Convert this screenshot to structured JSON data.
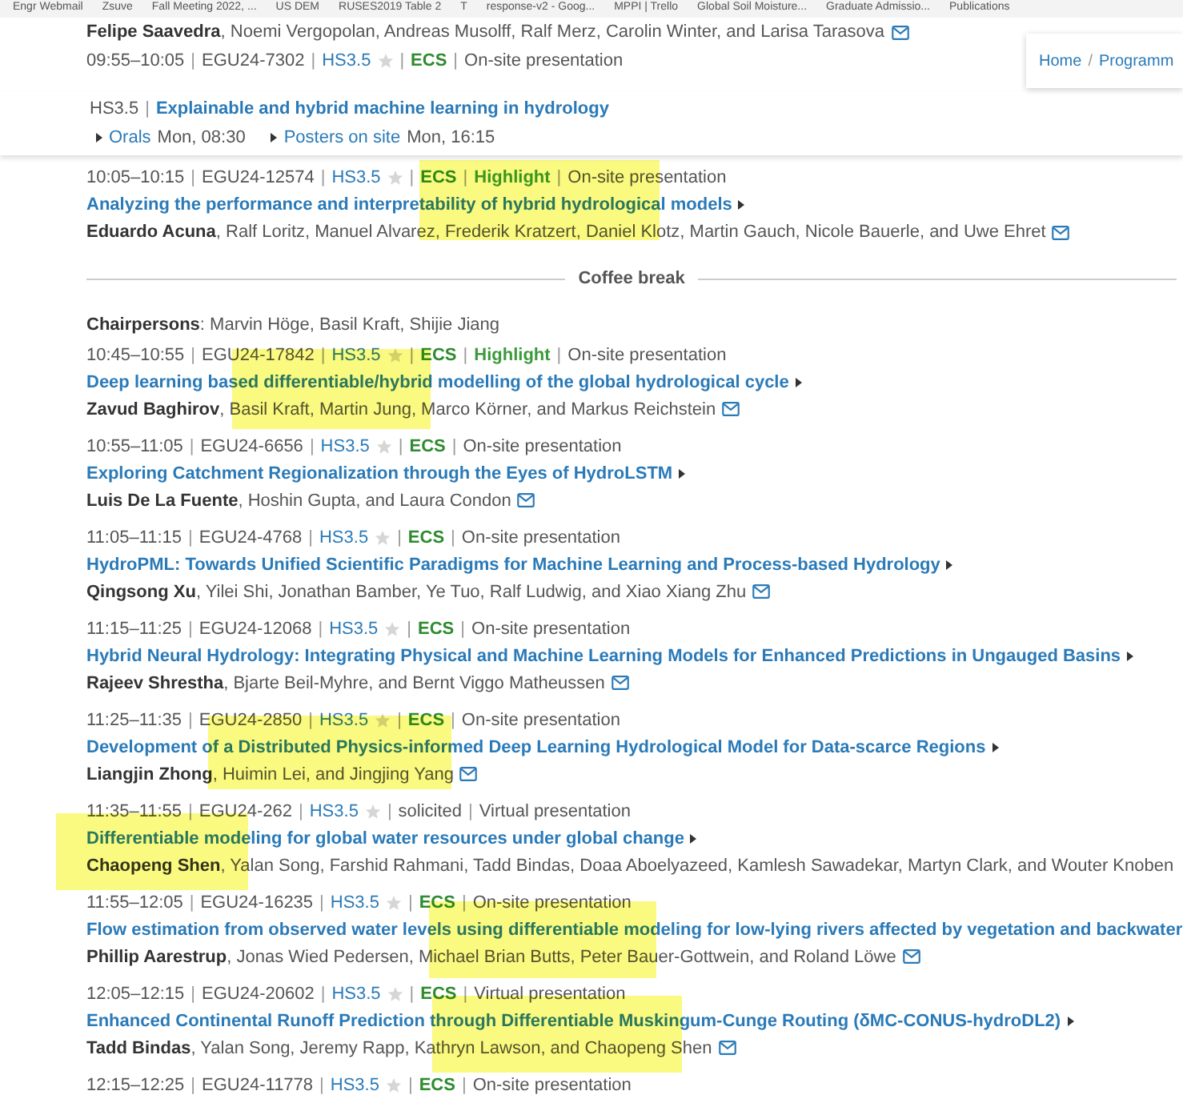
{
  "bookmarks": [
    "Engr Webmail",
    "Zsuve",
    "Fall Meeting 2022, ...",
    "US DEM",
    "RUSES2019 Table 2",
    "T",
    "response-v2 - Goog...",
    "MPPI | Trello",
    "Global Soil Moisture...",
    "Graduate Admissio...",
    "Publications"
  ],
  "separator": "|",
  "breadcrumb": {
    "items": [
      "Home",
      "Programm"
    ],
    "separator": "/"
  },
  "previous": {
    "first_author": "Felipe Saavedra",
    "authors": ", Noemi Vergopolan, Andreas Musolff, Ralf Merz, Carolin Winter, and Larisa Tarasova",
    "meta": {
      "time": "09:55–10:05",
      "abstract_id": "EGU24-7302",
      "session": "HS3.5",
      "starred": false,
      "tags": [
        {
          "kind": "ecs",
          "label": "ECS"
        }
      ],
      "presentation": "On-site presentation"
    }
  },
  "session_header": {
    "code": "HS3.5",
    "title": "Explainable and hybrid machine learning in hydrology",
    "links": [
      {
        "label": "Orals",
        "when": "Mon, 08:30"
      },
      {
        "label": "Posters on site",
        "when": "Mon, 16:15"
      }
    ]
  },
  "blocks": [
    {
      "kind": "talk",
      "time": "10:05–10:15",
      "abstract_id": "EGU24-12574",
      "session": "HS3.5",
      "starred": false,
      "tags": [
        {
          "kind": "ecs",
          "label": "ECS"
        },
        {
          "kind": "highlight",
          "label": "Highlight"
        }
      ],
      "presentation": "On-site presentation",
      "title": "Analyzing the performance and interpretability of hybrid hydrological models",
      "first_author": "Eduardo Acuna",
      "authors": ", Ralf Loritz, Manuel Alvarez, Frederik Kratzert, Daniel Klotz, Martin Gauch, Nicole Bauerle, and Uwe Ehret"
    },
    {
      "kind": "break",
      "label": "Coffee break"
    },
    {
      "kind": "chairs",
      "label": "Chairpersons",
      "names": ": Marvin Höge, Basil Kraft, Shijie Jiang"
    },
    {
      "kind": "talk",
      "time": "10:45–10:55",
      "abstract_id": "EGU24-17842",
      "session": "HS3.5",
      "starred": false,
      "tags": [
        {
          "kind": "ecs",
          "label": "ECS"
        },
        {
          "kind": "highlight",
          "label": "Highlight"
        }
      ],
      "presentation": "On-site presentation",
      "title": "Deep learning based differentiable/hybrid modelling of the global hydrological cycle",
      "first_author": "Zavud Baghirov",
      "authors": ", Basil Kraft, Martin Jung, Marco Körner, and Markus Reichstein"
    },
    {
      "kind": "talk",
      "time": "10:55–11:05",
      "abstract_id": "EGU24-6656",
      "session": "HS3.5",
      "starred": false,
      "tags": [
        {
          "kind": "ecs",
          "label": "ECS"
        }
      ],
      "presentation": "On-site presentation",
      "title": "Exploring Catchment Regionalization through the Eyes of HydroLSTM",
      "first_author": "Luis De La Fuente",
      "authors": ", Hoshin Gupta, and Laura Condon"
    },
    {
      "kind": "talk",
      "time": "11:05–11:15",
      "abstract_id": "EGU24-4768",
      "session": "HS3.5",
      "starred": false,
      "tags": [
        {
          "kind": "ecs",
          "label": "ECS"
        }
      ],
      "presentation": "On-site presentation",
      "title": "HydroPML: Towards Unified Scientific Paradigms for Machine Learning and Process-based Hydrology",
      "first_author": "Qingsong Xu",
      "authors": ", Yilei Shi, Jonathan Bamber, Ye Tuo, Ralf Ludwig, and Xiao Xiang Zhu"
    },
    {
      "kind": "talk",
      "time": "11:15–11:25",
      "abstract_id": "EGU24-12068",
      "session": "HS3.5",
      "starred": false,
      "tags": [
        {
          "kind": "ecs",
          "label": "ECS"
        }
      ],
      "presentation": "On-site presentation",
      "title": "Hybrid Neural Hydrology: Integrating Physical and Machine Learning Models for Enhanced Predictions in Ungauged Basins",
      "first_author": "Rajeev Shrestha",
      "authors": ", Bjarte Beil-Myhre, and Bernt Viggo Matheussen"
    },
    {
      "kind": "talk",
      "time": "11:25–11:35",
      "abstract_id": "EGU24-2850",
      "session": "HS3.5",
      "starred": false,
      "tags": [
        {
          "kind": "ecs",
          "label": "ECS"
        }
      ],
      "presentation": "On-site presentation",
      "title": "Development of a Distributed Physics-informed Deep Learning Hydrological Model for Data-scarce Regions",
      "first_author": "Liangjin Zhong",
      "authors": ", Huimin Lei, and Jingjing Yang"
    },
    {
      "kind": "talk",
      "time": "11:35–11:55",
      "abstract_id": "EGU24-262",
      "session": "HS3.5",
      "starred": false,
      "tags": [
        {
          "kind": "plain",
          "label": "solicited"
        }
      ],
      "presentation": "Virtual presentation",
      "title": "Differentiable modeling for global water resources under global change",
      "first_author": "Chaopeng Shen",
      "authors": ", Yalan Song, Farshid Rahmani, Tadd Bindas, Doaa Aboelyazeed, Kamlesh Sawadekar, Martyn Clark, and Wouter Knoben"
    },
    {
      "kind": "talk",
      "time": "11:55–12:05",
      "abstract_id": "EGU24-16235",
      "session": "HS3.5",
      "starred": false,
      "tags": [
        {
          "kind": "ecs",
          "label": "ECS"
        }
      ],
      "presentation": "On-site presentation",
      "title": "Flow estimation from observed water levels using differentiable modeling for low-lying rivers affected by vegetation and backwater",
      "first_author": "Phillip Aarestrup",
      "authors": ", Jonas Wied Pedersen, Michael Brian Butts, Peter Bauer-Gottwein, and Roland Löwe"
    },
    {
      "kind": "talk",
      "time": "12:05–12:15",
      "abstract_id": "EGU24-20602",
      "session": "HS3.5",
      "starred": false,
      "tags": [
        {
          "kind": "ecs",
          "label": "ECS"
        }
      ],
      "presentation": "Virtual presentation",
      "title": "Enhanced Continental Runoff Prediction through Differentiable Muskingum-Cunge Routing (δMC-CONUS-hydroDL2)",
      "first_author": "Tadd Bindas",
      "authors": ", Yalan Song, Jeremy Rapp, Kathryn Lawson, and Chaopeng Shen"
    },
    {
      "kind": "talk",
      "time": "12:15–12:25",
      "abstract_id": "EGU24-11778",
      "session": "HS3.5",
      "starred": false,
      "tags": [
        {
          "kind": "ecs",
          "label": "ECS"
        }
      ],
      "presentation": "On-site presentation"
    }
  ]
}
